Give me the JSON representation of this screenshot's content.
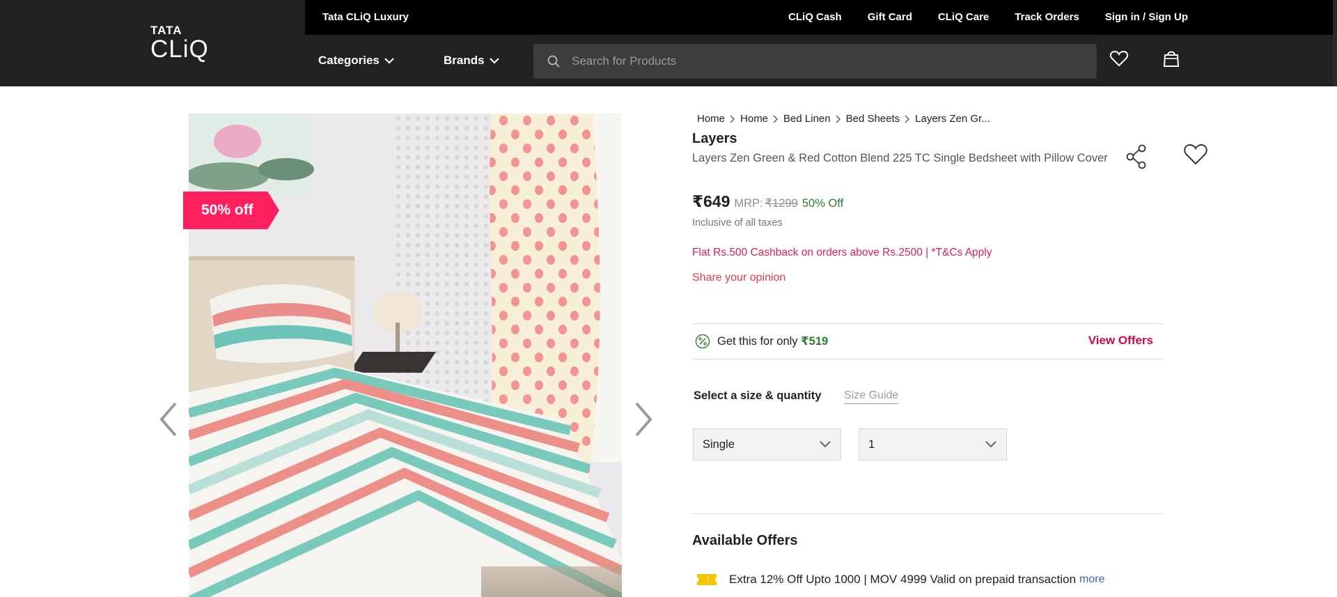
{
  "header": {
    "logo_top": "TATA",
    "logo_bottom": "CLiQ",
    "luxury_link": "Tata CLiQ Luxury",
    "top_links": [
      "CLiQ Cash",
      "Gift Card",
      "CLiQ Care",
      "Track Orders",
      "Sign in / Sign Up"
    ],
    "categories_label": "Categories",
    "brands_label": "Brands",
    "search_placeholder": "Search for Products"
  },
  "product": {
    "discount_tag": "50% off",
    "breadcrumbs": [
      "Home",
      "Home",
      "Bed Linen",
      "Bed Sheets",
      "Layers Zen Gr..."
    ],
    "brand": "Layers",
    "name": "Layers Zen Green & Red Cotton Blend 225 TC Single Bedsheet with Pillow Cover",
    "price": "₹649",
    "mrp_label": "MRP:",
    "mrp_value": "₹1299",
    "discount_text": "50% Off",
    "tax_note": "Inclusive of all taxes",
    "cashback": "Flat Rs.500 Cashback on orders above Rs.2500 | *T&Cs Apply",
    "opinion_link": "Share your opinion"
  },
  "offer_banner": {
    "text": "Get this for only",
    "amount": "₹519",
    "view_offers": "View Offers"
  },
  "size_section": {
    "label": "Select a size & quantity",
    "size_guide": "Size Guide",
    "size_value": "Single",
    "quantity_value": "1"
  },
  "available_offers": {
    "title": "Available Offers",
    "items": [
      {
        "text": "Extra 12% Off Upto 1000 | MOV 4999 Valid on prepaid transaction",
        "more": "more"
      }
    ]
  },
  "colors": {
    "header_bg": "#212121",
    "topbar_bg": "#000000",
    "discount_tag": "#ff1f5f",
    "offer_green": "#2e7d32",
    "accent_pink": "#d7064c"
  }
}
